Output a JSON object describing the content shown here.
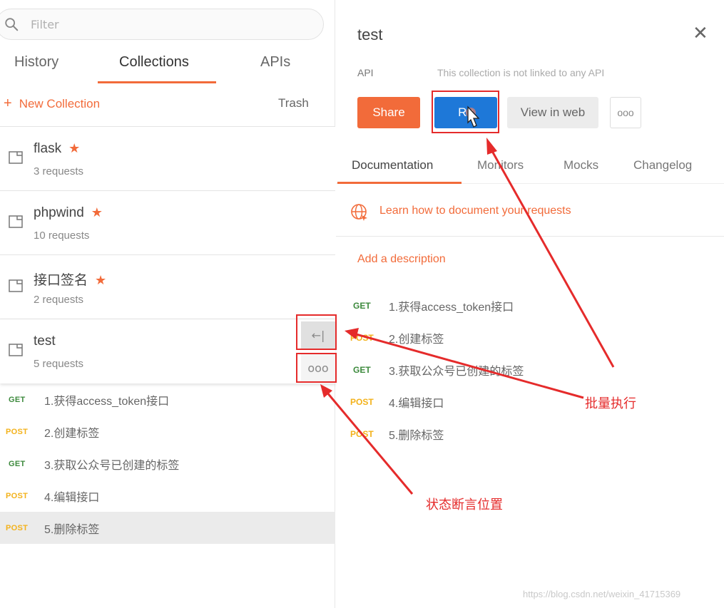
{
  "sidebar": {
    "filter_placeholder": "Filter",
    "tabs": [
      {
        "label": "History"
      },
      {
        "label": "Collections"
      },
      {
        "label": "APIs"
      }
    ],
    "new_collection_label": "New Collection",
    "trash_label": "Trash",
    "collections": [
      {
        "name": "flask",
        "count": "3 requests"
      },
      {
        "name": "phpwind",
        "count": "10 requests"
      },
      {
        "name": "接口签名",
        "count": "2 requests"
      },
      {
        "name": "test",
        "count": "5 requests"
      }
    ],
    "star": "★",
    "collapse_glyph": "←|",
    "more_glyph": "ooo",
    "requests": [
      {
        "method": "GET",
        "title": "1.获得access_token接口"
      },
      {
        "method": "POST",
        "title": "2.创建标签"
      },
      {
        "method": "GET",
        "title": "3.获取公众号已创建的标签"
      },
      {
        "method": "POST",
        "title": "4.编辑接口"
      },
      {
        "method": "POST",
        "title": "5.删除标签"
      }
    ]
  },
  "detail": {
    "title": "test",
    "close_glyph": "✕",
    "api_label": "API",
    "api_note": "This collection is not linked to any API",
    "buttons": {
      "share": "Share",
      "run": "Ru",
      "view": "View in web",
      "more": "ooo"
    },
    "tabs": [
      {
        "label": "Documentation"
      },
      {
        "label": "Monitors"
      },
      {
        "label": "Mocks"
      },
      {
        "label": "Changelog"
      }
    ],
    "learn_link": "Learn how to document your requests",
    "add_description": "Add a description",
    "requests": [
      {
        "method": "GET",
        "title": "1.获得access_token接口"
      },
      {
        "method": "POST",
        "title": "2.创建标签"
      },
      {
        "method": "GET",
        "title": "3.获取公众号已创建的标签"
      },
      {
        "method": "POST",
        "title": "4.编辑接口"
      },
      {
        "method": "POST",
        "title": "5.删除标签"
      }
    ]
  },
  "annotations": {
    "batch_run": "批量执行",
    "assert_location": "状态断言位置"
  },
  "watermark": "https://blog.csdn.net/weixin_41715369",
  "colors": {
    "accent": "#f26b3a",
    "run_blue": "#1e78d8",
    "get_green": "#3d8a3d",
    "post_yellow": "#f3b21b",
    "annotation_red": "#e52b2b"
  }
}
